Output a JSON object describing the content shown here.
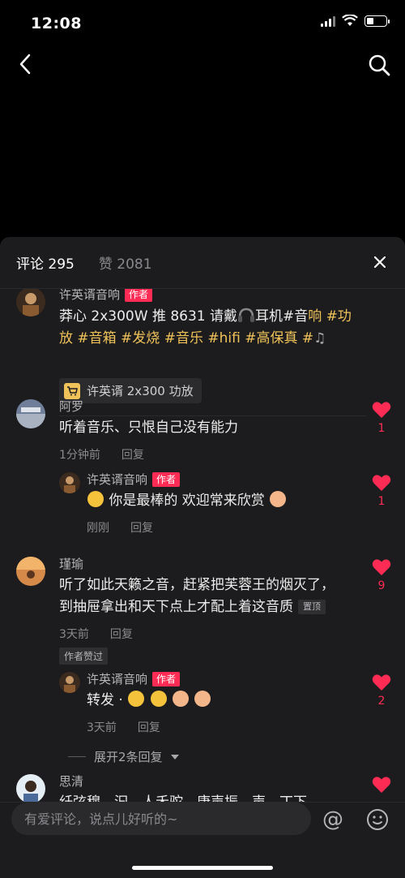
{
  "status_bar": {
    "time": "12:08",
    "battery_level": 0.35
  },
  "nav": {
    "back_icon": "chevron-left-icon",
    "search_icon": "search-icon"
  },
  "tabs": [
    {
      "label": "评论 295",
      "active": true
    },
    {
      "label": "赞 2081",
      "active": false
    }
  ],
  "comments": [
    {
      "username": "许英谞音响",
      "author_tag": "作者",
      "text_line1_parts": [
        "莽心 2x300W 推 8631 请戴",
        "耳机#音",
        "响",
        " #功"
      ],
      "text_line2": "放 #音箱 #发烧 #音乐 #hifi #高保真 #",
      "product_label": "许英谞 2x300 功放"
    },
    {
      "username": "阿罗",
      "text": "听着音乐、只恨自己没有能力",
      "time": "1分钟前",
      "reply_label": "回复",
      "likes": "1"
    },
    {
      "username": "许英谞音响",
      "author_tag": "作者",
      "text": "你是最棒的 欢迎常来欣赏",
      "time": "刚刚",
      "reply_label": "回复",
      "likes": "1"
    },
    {
      "username": "瑾瑜",
      "text_line1": "听了如此天籁之音，赶紧把芙蓉王的烟灭了，",
      "text_line2": "到抽屉拿出和天下点上才配上着这音质",
      "pinned": "置顶",
      "time": "3天前",
      "reply_label": "回复",
      "likes": "9",
      "author_liked": "作者赞过"
    },
    {
      "username": "许英谞音响",
      "author_tag": "作者",
      "text": "转发 ·",
      "time": "3天前",
      "reply_label": "回复",
      "likes": "2",
      "expand_label": "展开2条回复"
    },
    {
      "username": "思清",
      "text": "纤弦穆、汩、人禾驼、康声振、声、丁下",
      "likes": ""
    }
  ],
  "input": {
    "placeholder": "有爱评论，说点儿好听的~"
  },
  "colors": {
    "accent": "#fe2c55",
    "highlight": "#f0c35a",
    "sheet": "#1c1c1e"
  }
}
